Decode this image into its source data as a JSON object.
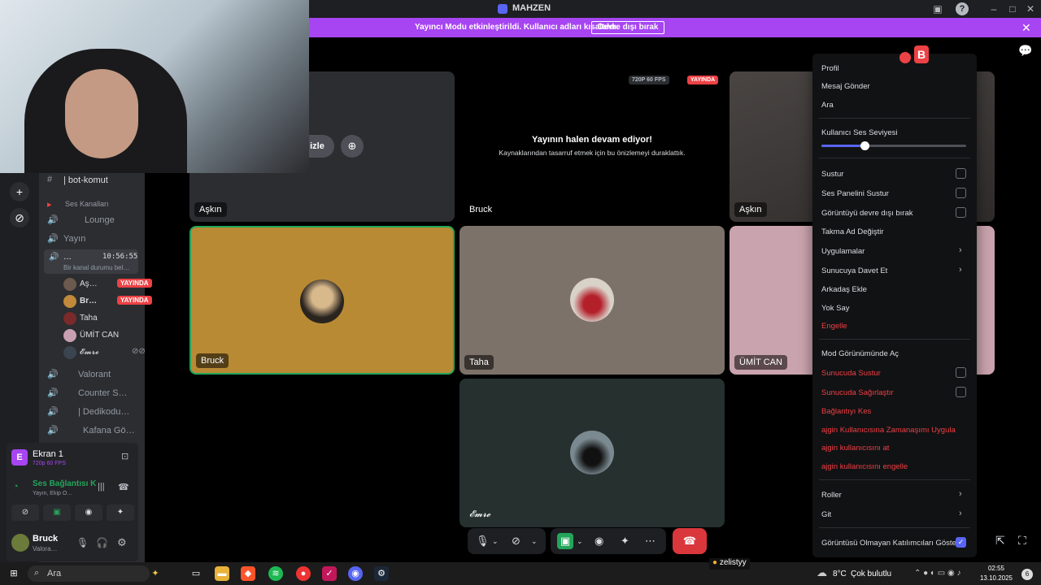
{
  "window": {
    "title": "MAHZEN"
  },
  "banner": {
    "message": "Yayıncı Modu etkinleştirildi. Kullanıcı adları kısaltıldı.",
    "button": "Devre dışı bırak"
  },
  "channels": {
    "text_channel": "| bot-komut",
    "voice_category": "Ses Kanalları",
    "items": [
      {
        "name": "Lounge"
      },
      {
        "name": "Yayın"
      },
      {
        "name": "…",
        "time": "10:56:55",
        "status": "Bir kanal durumu bel…"
      },
      {
        "name": "Valorant"
      },
      {
        "name": "Counter S…"
      },
      {
        "name": "| Dedikodu…"
      },
      {
        "name": "Kafana Gö…"
      }
    ],
    "users": [
      {
        "name": "Aş…",
        "badge": "YAYINDA"
      },
      {
        "name": "Br…",
        "badge": "YAYINDA"
      },
      {
        "name": "Taha",
        "badge": ""
      },
      {
        "name": "ÜMİT CAN",
        "badge": ""
      },
      {
        "name": "𝓔𝓶𝓻𝓮",
        "badge": ""
      }
    ]
  },
  "voice_panel": {
    "screen_title": "Ekran 1",
    "screen_quality": "720p 60 FPS",
    "connection": "Ses Bağlantısı K",
    "connection_sub": "Yayın, Ekip O…",
    "user_name": "Bruck",
    "user_status": "Valora…"
  },
  "stage": {
    "watch_label": "ı izle",
    "stream_quality": "720P 60 FPS",
    "stream_live": "YAYINDA",
    "paused_title": "Yayının halen devam ediyor!",
    "paused_sub": "Kaynaklarından tasarruf etmek için bu önizlemeyi duraklattık.",
    "tiles": [
      {
        "name": "Aşkın"
      },
      {
        "name": "Bruck"
      },
      {
        "name": "Aşkın"
      },
      {
        "name": "Bruck"
      },
      {
        "name": "Taha"
      },
      {
        "name": "ÜMİT CAN"
      },
      {
        "name": "𝓔𝓶𝓻𝓮"
      }
    ]
  },
  "context_menu": {
    "profile": "Profil",
    "send_message": "Mesaj Gönder",
    "call": "Ara",
    "volume_label": "Kullanıcı Ses Seviyesi",
    "volume_fraction": 0.3,
    "mute": "Sustur",
    "mute_soundboard": "Ses Panelini Sustur",
    "disable_video": "Görüntüyü devre dışı bırak",
    "change_nickname": "Takma Ad Değiştir",
    "apps": "Uygulamalar",
    "invite": "Sunucuya Davet Et",
    "add_friend": "Arkadaş Ekle",
    "ignore": "Yok Say",
    "block": "Engelle",
    "mod_view": "Mod Görünümünde Aç",
    "server_mute": "Sunucuda Sustur",
    "server_deafen": "Sunucuda Sağırlaştır",
    "disconnect": "Bağlantıyı Kes",
    "timeout": "ajgin Kullanıcısına Zamanaşımı Uygula",
    "kick": "ajgin kullanıcısını at",
    "ban": "ajgin kullanıcısını engelle",
    "roles": "Roller",
    "go": "Git",
    "show_non_video": "Görüntüsü Olmayan Katılımcıları Göster"
  },
  "taskbar": {
    "search": "Ara",
    "weather_temp": "8°C",
    "weather_text": "Çok bulutlu",
    "time": "02:55",
    "date": "13.10.2025",
    "notification": "6",
    "user_tag": "zelistyy"
  }
}
